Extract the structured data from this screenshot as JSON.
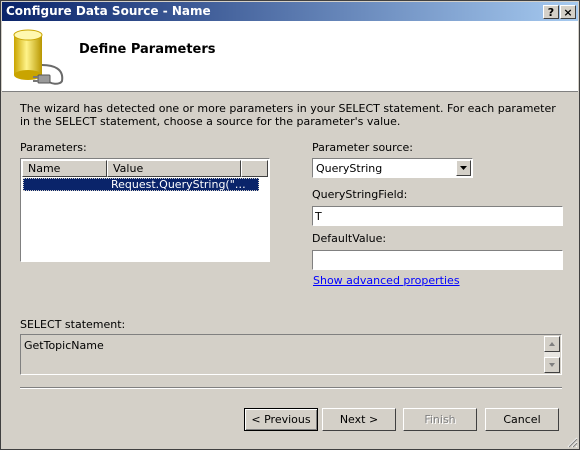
{
  "window": {
    "title": "Configure Data Source - Name",
    "help_button": "?",
    "close_button": "×"
  },
  "header": {
    "title": "Define Parameters",
    "icon": "database-icon"
  },
  "instructions": "The wizard has detected one or more parameters in your SELECT statement. For each parameter in the SELECT statement, choose a source for the parameter's value.",
  "parameters": {
    "label": "Parameters:",
    "columns": [
      "Name",
      "Value"
    ],
    "rows": [
      {
        "name": "",
        "value": "Request.QueryString(\"…",
        "selected": true
      }
    ]
  },
  "parameter_source": {
    "label": "Parameter source:",
    "value": "QueryString"
  },
  "querystring_field": {
    "label": "QueryStringField:",
    "value": "T"
  },
  "default_value": {
    "label": "DefaultValue:",
    "value": ""
  },
  "advanced_link": "Show advanced properties",
  "select_statement": {
    "label": "SELECT statement:",
    "value": "GetTopicName"
  },
  "buttons": {
    "previous": "< Previous",
    "next": "Next >",
    "finish": "Finish",
    "cancel": "Cancel"
  },
  "colors": {
    "title_gradient_start": "#0a246a",
    "title_gradient_end": "#a6caf0",
    "selection": "#0a246a",
    "link": "#0000ff",
    "face": "#d4d0c8"
  }
}
